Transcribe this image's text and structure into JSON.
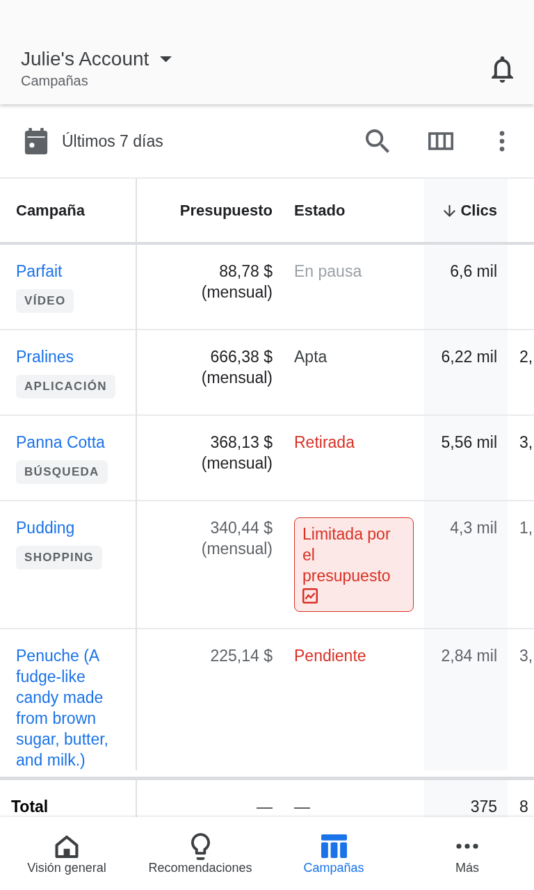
{
  "header": {
    "account": "Julie's Account",
    "subtitle": "Campañas"
  },
  "toolbar": {
    "date_range": "Últimos 7 días"
  },
  "table": {
    "columns": [
      {
        "label": "Campaña",
        "sorted": false
      },
      {
        "label": "Presupuesto",
        "sorted": false
      },
      {
        "label": "Estado",
        "sorted": false
      },
      {
        "label": "Clics",
        "sorted": true
      }
    ],
    "rows": [
      {
        "name": "Parfait",
        "type": "VÍDEO",
        "budget": "88,78 $",
        "budget_period": "(mensual)",
        "status": {
          "text": "En pausa",
          "kind": "paused"
        },
        "clicks": "6,6 mil",
        "dimmed": false
      },
      {
        "name": "Pralines",
        "type": "APLICACIÓN",
        "budget": "666,38 $",
        "budget_period": "(mensual)",
        "status": {
          "text": "Apta",
          "kind": "eligible"
        },
        "clicks": "6,22 mil",
        "column_6": "2,",
        "dimmed": false
      },
      {
        "name": "Panna Cotta",
        "type": "BÚSQUEDA",
        "budget": "368,13 $",
        "budget_period": "(mensual)",
        "status": {
          "text": "Retirada",
          "kind": "removed"
        },
        "clicks": "5,56 mil",
        "column_6": "3,",
        "dimmed": false
      },
      {
        "name": "Pudding",
        "type": "SHOPPING",
        "budget": "340,44 $",
        "budget_period": "(mensual)",
        "status": {
          "text": "Limitada por el presupuesto",
          "kind": "limited"
        },
        "clicks": "4,3 mil",
        "column_6": "1,",
        "dimmed": true
      },
      {
        "name": "Penuche (A fudge-like candy made from brown sugar, butter, and milk.)",
        "budget": "225,14 $",
        "status": {
          "text": "Pendiente",
          "kind": "pending"
        },
        "clicks": "2,84 mil",
        "column_6": "3,",
        "dimmed": true
      }
    ],
    "total": {
      "label": "Total",
      "budget": "—",
      "status": "—",
      "clicks": "375",
      "column_6": "8"
    }
  },
  "bottom_nav": [
    {
      "label": "Visión general",
      "kind": "home",
      "selected": false
    },
    {
      "label": "Recomendaciones",
      "kind": "lightbulb",
      "selected": false
    },
    {
      "label": "Campañas",
      "kind": "campaigns",
      "selected": true
    },
    {
      "label": "Más",
      "kind": "more",
      "selected": false
    }
  ]
}
